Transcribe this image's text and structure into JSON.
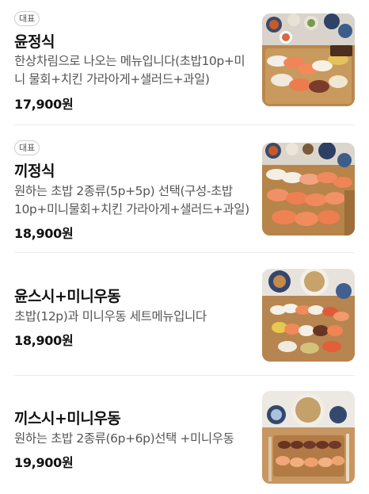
{
  "menu": {
    "items": [
      {
        "badge": "대표",
        "name": "윤정식",
        "description": "한상차림으로 나오는 메뉴입니다(초밥10p+미니 물회+치킨 가라아게+샐러드+과일)",
        "price": "17,900원",
        "image": "sushi-set-platter-photo"
      },
      {
        "badge": "대표",
        "name": "끼정식",
        "description": "원하는 초밥 2종류(5p+5p) 선택(구성-초밥10p+미니물회+치킨 가라아게+샐러드+과일)",
        "price": "18,900원",
        "image": "salmon-sushi-platter-photo"
      },
      {
        "badge": "",
        "name": "윤스시+미니우동",
        "description": "초밥(12p)과 미니우동 세트메뉴입니다",
        "price": "18,900원",
        "image": "sushi-udon-set-photo"
      },
      {
        "badge": "",
        "name": "끼스시+미니우동",
        "description": "원하는 초밥 2종류(6p+6p)선택 +미니우동",
        "price": "19,900원",
        "image": "sushi-udon-choice-set-photo"
      }
    ]
  },
  "colors": {
    "text_primary": "#111111",
    "text_secondary": "#555555",
    "divider": "#ececec",
    "badge_border": "#cfcfcf"
  }
}
